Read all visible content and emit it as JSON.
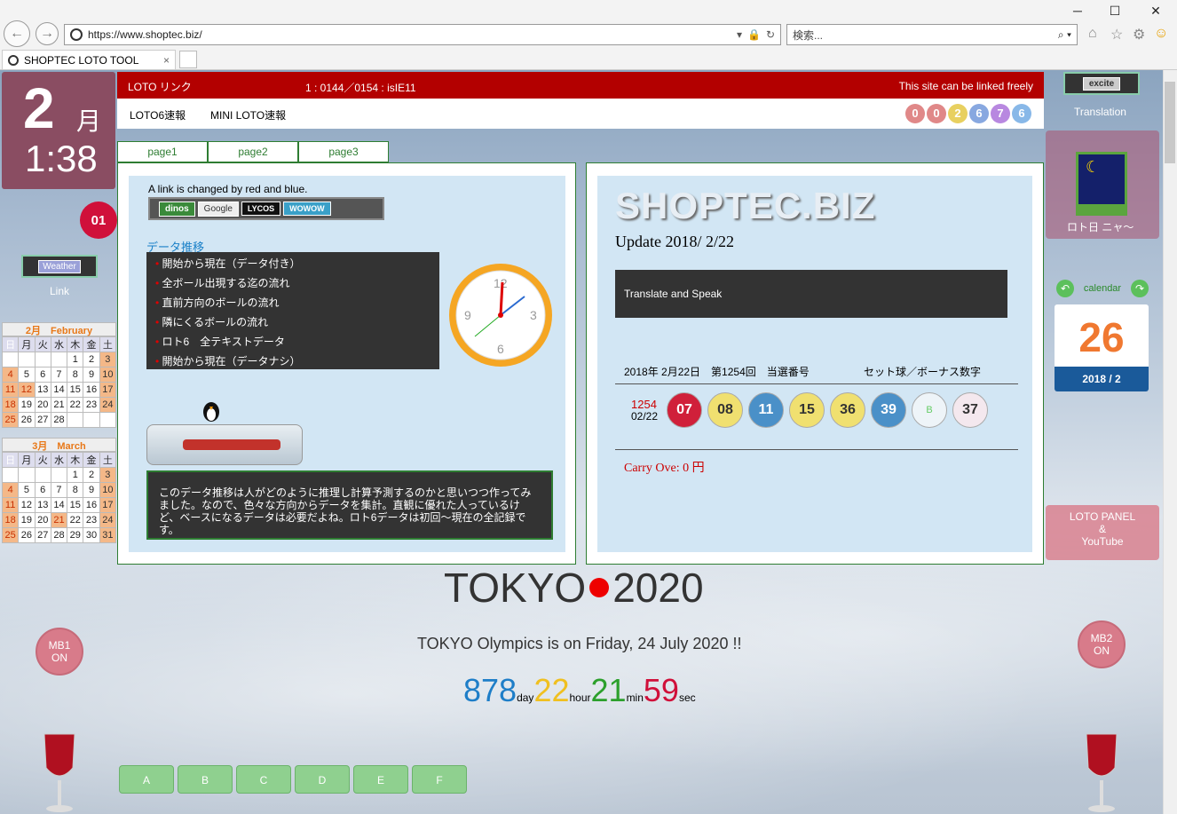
{
  "browser": {
    "url": "https://www.shoptec.biz/",
    "search_placeholder": "検索...",
    "tab_title": "SHOPTEC LOTO TOOL",
    "win_minimize": "─",
    "win_maximize": "☐",
    "win_close": "✕"
  },
  "left": {
    "month_num": "2",
    "month_kanji": "月",
    "time": "1:38",
    "badge": "01",
    "weather_label": "Weather",
    "link_label": "Link",
    "feb": {
      "title": "2月　February",
      "weekdays": [
        "日",
        "月",
        "火",
        "水",
        "木",
        "金",
        "土"
      ],
      "rows": [
        [
          "",
          "",
          "",
          "",
          "1",
          "2",
          "3"
        ],
        [
          "4",
          "5",
          "6",
          "7",
          "8",
          "9",
          "10"
        ],
        [
          "11",
          "12",
          "13",
          "14",
          "15",
          "16",
          "17"
        ],
        [
          "18",
          "19",
          "20",
          "21",
          "22",
          "23",
          "24"
        ],
        [
          "25",
          "26",
          "27",
          "28",
          "",
          "",
          ""
        ]
      ]
    },
    "mar": {
      "title": "3月　March",
      "weekdays": [
        "日",
        "月",
        "火",
        "水",
        "木",
        "金",
        "土"
      ],
      "rows": [
        [
          "",
          "",
          "",
          "",
          "1",
          "2",
          "3"
        ],
        [
          "4",
          "5",
          "6",
          "7",
          "8",
          "9",
          "10"
        ],
        [
          "11",
          "12",
          "13",
          "14",
          "15",
          "16",
          "17"
        ],
        [
          "18",
          "19",
          "20",
          "21",
          "22",
          "23",
          "24"
        ],
        [
          "25",
          "26",
          "27",
          "28",
          "29",
          "30",
          "31"
        ]
      ]
    },
    "mb1": [
      "MB1",
      "ON"
    ]
  },
  "header": {
    "loto_link": "LOTO リンク",
    "counter": "1 : 0144／0154 : isIE11",
    "linked": "This site can be linked freely",
    "loto6": "LOTO6速報",
    "mini": "MINI LOTO速報",
    "balls": [
      "0",
      "0",
      "2",
      "6",
      "7",
      "6"
    ]
  },
  "tabs": [
    "page1",
    "page2",
    "page3"
  ],
  "leftpanel": {
    "note": "A link is changed by red and blue.",
    "links": [
      "dinos",
      "Google",
      "LYCOS",
      "WOWOW"
    ],
    "heading": "データ推移",
    "items": [
      "開始から現在（データ付き）",
      "全ボール出現する迄の流れ",
      "直前方向のボールの流れ",
      "隣にくるボールの流れ",
      "ロト6　全テキストデータ",
      "開始から現在（データナシ）"
    ],
    "desc": "このデータ推移は人がどのように推理し計算予測するのかと思いつつ作ってみました。なので、色々な方向からデータを集計。直観に優れた人っているけど、ベースになるデータは必要だよね。ロト6データは初回～現在の全記録です。",
    "clock_labels": [
      "12",
      "3",
      "6",
      "9"
    ]
  },
  "rightpanel": {
    "logo": "SHOPTEC.BIZ",
    "update": "Update 2018/ 2/22",
    "translate": "Translate and Speak",
    "draw_date": "2018年 2月22日　第1254回　当選番号",
    "set_label": "セット球／ボーナス数字",
    "round": "1254",
    "round_date": "02/22",
    "numbers": [
      "07",
      "08",
      "11",
      "15",
      "36",
      "39"
    ],
    "set_ball": "B",
    "bonus": "37",
    "carry": "Carry Ove: 0 円"
  },
  "right": {
    "excite": "excite",
    "translation": "Translation",
    "lotoday": "ロト日 ニャ〜",
    "calendar": "calendar",
    "cal_day": "26",
    "cal_month": "2018 / 2",
    "panel": [
      "LOTO PANEL",
      "&",
      "YouTube"
    ],
    "mb2": [
      "MB2",
      "ON"
    ]
  },
  "center": {
    "tokyo": "TOKYO",
    "year": "2020",
    "olympics": "TOKYO Olympics is on Friday, 24 July 2020 !!",
    "countdown": {
      "days": "878",
      "day_u": "day",
      "hours": "22",
      "hour_u": "hour",
      "mins": "21",
      "min_u": "min",
      "secs": "59",
      "sec_u": "sec"
    }
  },
  "pills": [
    "A",
    "B",
    "C",
    "D",
    "E",
    "F"
  ],
  "colors": {
    "red": "#b30000",
    "green": "#2e7d32",
    "countdown_day": "#1e7ec8",
    "countdown_hour": "#f0c020",
    "countdown_min": "#2ca02c",
    "countdown_sec": "#d0103a"
  }
}
